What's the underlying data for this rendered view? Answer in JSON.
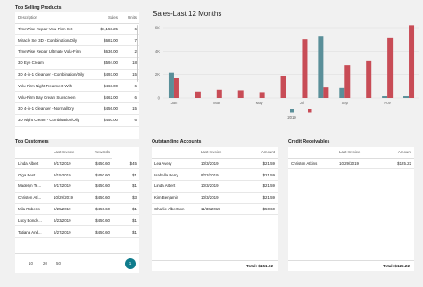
{
  "top_selling": {
    "title": "Top Selling Products",
    "columns": [
      "Description",
      "Sales",
      "Units"
    ],
    "rows": [
      [
        "TimeWise Repair Volu-Firm Set",
        "$1,158.25",
        "6"
      ],
      [
        "Miracle Set 3D - Combination/Oily",
        "$682.00",
        "7"
      ],
      [
        "TimeWise Repair Ultimate Volu-Firm",
        "$636.00",
        "2"
      ],
      [
        "3D Eye Cream",
        "$594.00",
        "18"
      ],
      [
        "3D 4-in-1 Cleanser - Combination/Oily",
        "$493.00",
        "15"
      ],
      [
        "Volu-Firm Night Treatment With",
        "$468.00",
        "6"
      ],
      [
        "Volu-Firm Day Cream Sunscreen",
        "$462.00",
        "6"
      ],
      [
        "3D 4-in-1 Cleanser - Normal/Dry",
        "$456.00",
        "15"
      ],
      [
        "3D Night Cream - Combination/Oily",
        "$450.00",
        "6"
      ]
    ]
  },
  "sales_chart": {
    "title": "Sales-Last 12 Months"
  },
  "chart_data": {
    "type": "bar",
    "title": "Sales-Last 12 Months",
    "categories": [
      "Jan",
      "Feb",
      "Mar",
      "Apr",
      "May",
      "Jun",
      "Jul",
      "Aug",
      "Sep",
      "Oct",
      "Nov",
      "Dec"
    ],
    "category_labels": [
      "Jan",
      "",
      "Mar",
      "",
      "May",
      "",
      "Jul",
      "",
      "Sep",
      "",
      "Nov",
      ""
    ],
    "series": [
      {
        "name": "2019",
        "color": "#5a8f99",
        "values": [
          2150,
          0,
          0,
          0,
          0,
          0,
          0,
          5300,
          850,
          0,
          150,
          150
        ]
      },
      {
        "name": "",
        "color": "#c84c56",
        "values": [
          1700,
          550,
          700,
          650,
          500,
          1900,
          5000,
          900,
          2800,
          3200,
          5100,
          6200
        ]
      }
    ],
    "legend_labels": [
      "2019",
      ""
    ],
    "ylim": [
      0,
      6000
    ],
    "yticks": [
      "0",
      "2K",
      "4K",
      "6K"
    ],
    "ytick_values": [
      0,
      2000,
      4000,
      6000
    ],
    "legend": "bottom-left",
    "grid": true
  },
  "top_customers": {
    "title": "Top Customers",
    "columns": [
      "",
      "Last Invoice",
      "Rewards"
    ],
    "rows": [
      [
        "Linda Albert",
        "9/17/2019",
        "$450.60",
        "$45"
      ],
      [
        "Olga Best",
        "9/15/2019",
        "$450.60",
        "$1"
      ],
      [
        "Madelyn Te...",
        "9/17/2019",
        "$450.60",
        "$1"
      ],
      [
        "Christen Atl...",
        "10/29/2019",
        "$450.60",
        "$3"
      ],
      [
        "Mila Roberts",
        "6/25/2019",
        "$450.60",
        "$1"
      ],
      [
        "Lucy Bonde...",
        "6/23/2019",
        "$450.60",
        "$1"
      ],
      [
        "Tatiana And...",
        "6/27/2019",
        "$450.60",
        "$1"
      ]
    ],
    "page_sizes": [
      "10",
      "20",
      "50"
    ],
    "current_page": "1"
  },
  "outstanding": {
    "title": "Outstanding Accounts",
    "columns": [
      "",
      "Last Invoice",
      "Amount"
    ],
    "rows": [
      [
        "Lea Avery",
        "10/3/2019",
        "$21.59"
      ],
      [
        "Isabella Berry",
        "9/23/2019",
        "$21.59"
      ],
      [
        "Linda Albert",
        "10/3/2019",
        "$21.59"
      ],
      [
        "Kim Benjamin",
        "10/3/2019",
        "$21.59"
      ],
      [
        "Charlie Albertson",
        "11/30/2015",
        "$50.60"
      ]
    ],
    "total": "Total: $151.02"
  },
  "receivables": {
    "title": "Credit Receivables",
    "columns": [
      "",
      "Last Invoice",
      "Amount"
    ],
    "rows": [
      [
        "Christen Atkins",
        "10/29/2019",
        "$125.22"
      ]
    ],
    "total": "Total: $125.22"
  }
}
